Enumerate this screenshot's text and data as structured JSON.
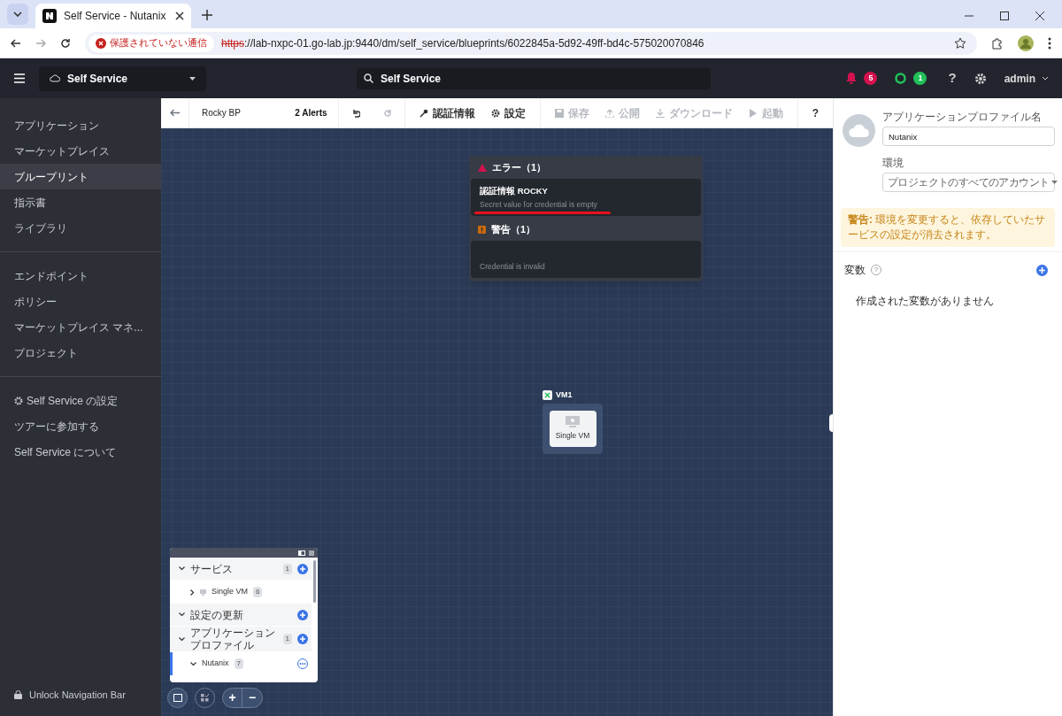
{
  "browser": {
    "tab_title": "Self Service - Nutanix",
    "security": "保護されていない通信",
    "url_scheme": "https",
    "url_rest": "://lab-nxpc-01.go-lab.jp:9440/dm/self_service/blueprints/6022845a-5d92-49ff-bd4c-575020070846"
  },
  "header": {
    "app_switcher": "Self Service",
    "search": "Self Service",
    "alerts_count": "5",
    "tasks_count": "1",
    "help": "?",
    "user": "admin"
  },
  "sidebar": {
    "sections": [
      [
        {
          "label": "アプリケーション",
          "kind": "plain",
          "selected": false
        },
        {
          "label": "マーケットプレイス",
          "kind": "plain",
          "selected": false
        },
        {
          "label": "ブループリント",
          "kind": "plain",
          "selected": true
        },
        {
          "label": "指示書",
          "kind": "plain",
          "selected": false
        },
        {
          "label": "ライブラリ",
          "kind": "plain",
          "selected": false
        }
      ],
      [
        {
          "label": "エンドポイント",
          "kind": "plain",
          "selected": false
        },
        {
          "label": "ポリシー",
          "kind": "plain",
          "selected": false
        },
        {
          "label": "マーケットプレイス マネ...",
          "kind": "plain",
          "selected": false
        },
        {
          "label": "プロジェクト",
          "kind": "plain",
          "selected": false
        }
      ],
      [
        {
          "label": "Self Service の設定",
          "kind": "gear",
          "selected": false
        },
        {
          "label": "ツアーに参加する",
          "kind": "plain",
          "selected": false
        },
        {
          "label": "Self Service について",
          "kind": "plain",
          "selected": false
        }
      ]
    ],
    "unlock": "Unlock Navigation Bar"
  },
  "toolbar": {
    "title": "Rocky BP",
    "alerts": "2 Alerts",
    "actions": [
      {
        "kind": "undo",
        "disabled": false
      },
      {
        "kind": "redo",
        "disabled": true
      },
      {
        "kind": "key",
        "label": "認証情報",
        "disabled": false
      },
      {
        "kind": "gear",
        "label": "設定",
        "disabled": false
      },
      {
        "kind": "save",
        "label": "保存",
        "disabled": true
      },
      {
        "kind": "upload",
        "label": "公開",
        "disabled": true
      },
      {
        "kind": "download",
        "label": "ダウンロード",
        "disabled": true
      },
      {
        "kind": "play",
        "label": "起動",
        "disabled": true
      },
      {
        "kind": "help",
        "label": "?",
        "disabled": false
      }
    ]
  },
  "alerts_popup": {
    "sections": [
      {
        "kind": "error",
        "title": "エラー（1）",
        "items": [
          {
            "title": "認証情報 ROCKY",
            "message": "Secret value for credential is empty",
            "underlined": true
          }
        ]
      },
      {
        "kind": "warning",
        "title": "警告（1）",
        "items": [
          {
            "message": "Credential is invalid",
            "underlined": false
          }
        ]
      }
    ]
  },
  "canvas": {
    "node": {
      "label": "VM1",
      "service": "Single VM"
    },
    "zoom_in": "+",
    "zoom_out": "−"
  },
  "tree": {
    "sections": [
      {
        "label": "サービス",
        "count": "1",
        "expanded": true,
        "children": [
          {
            "label": "Single VM",
            "count": "6",
            "expanded": false,
            "selected": false
          }
        ]
      },
      {
        "label": "設定の更新",
        "expanded": true
      },
      {
        "label": "アプリケーションプロファイル",
        "count": "1",
        "expanded": true,
        "children": [
          {
            "label": "Nutanix",
            "count": "7",
            "expanded": true,
            "selected": true
          }
        ]
      }
    ]
  },
  "panel": {
    "profile_label": "アプリケーションプロファイル名",
    "profile_name": "Nutanix",
    "env_label": "環境",
    "env_value": "プロジェクトのすべてのアカウント",
    "warning": "**警告:** 環境を変更すると、依存していたサービスの設定が消去されます。",
    "variables_label": "変数",
    "variables_help": "?",
    "variables_empty": "作成された変数がありません"
  }
}
